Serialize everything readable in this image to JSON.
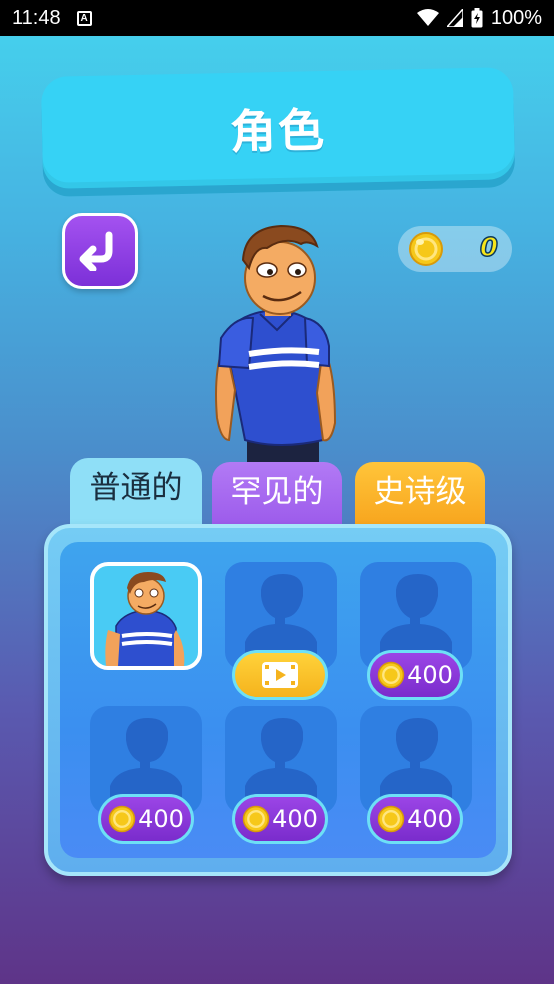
{
  "status_bar": {
    "time": "11:48",
    "notification_icon_letter": "A",
    "battery_percent": "100%"
  },
  "header": {
    "title": "角色"
  },
  "back_button": {
    "icon": "return-arrow-icon"
  },
  "coins": {
    "value": "0",
    "icon": "coin-icon"
  },
  "tabs": [
    {
      "label": "普通的",
      "selected": true,
      "color": "#8fdff7"
    },
    {
      "label": "罕见的",
      "selected": false,
      "color": "#9a58ea"
    },
    {
      "label": "史诗级",
      "selected": false,
      "color": "#f7a21b"
    }
  ],
  "characters": [
    {
      "state": "owned-selected"
    },
    {
      "state": "locked",
      "unlock": "watch-video",
      "icon": "video-icon"
    },
    {
      "state": "locked",
      "unlock": "coins",
      "price": "400"
    },
    {
      "state": "locked",
      "unlock": "coins",
      "price": "400"
    },
    {
      "state": "locked",
      "unlock": "coins",
      "price": "400"
    },
    {
      "state": "locked",
      "unlock": "coins",
      "price": "400"
    }
  ],
  "colors": {
    "accent_cyan": "#36d2f5",
    "purple": "#7c30d8",
    "coin_gold": "#f6c81a"
  }
}
